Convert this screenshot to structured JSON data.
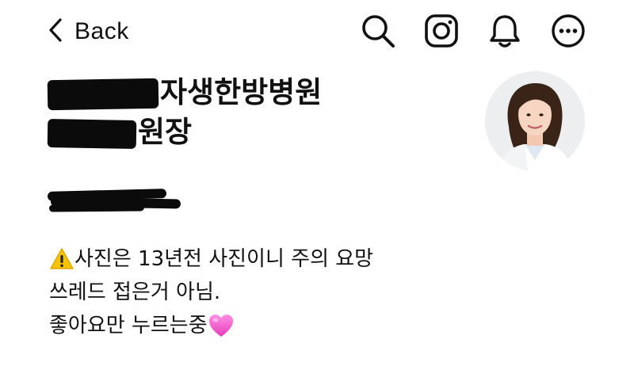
{
  "nav": {
    "back_label": "Back",
    "icons": [
      "search-icon",
      "instagram-icon",
      "bell-icon",
      "more-icon"
    ]
  },
  "profile": {
    "name_visible": "자생한방병원",
    "title_visible": "원장",
    "avatar_icon": "profile-photo"
  },
  "bio": {
    "line1": "사진은 13년전 사진이니 주의 요망",
    "line1_icon": "warning-icon",
    "line2": "쓰레드 접은거 아님.",
    "line3": "좋아요만 누르는중",
    "line3_icon": "pink-heart-icon"
  },
  "colors": {
    "text": "#111111",
    "redaction": "#0b0b0b",
    "warning": "#f5c400",
    "heart": "#f06ad0"
  }
}
